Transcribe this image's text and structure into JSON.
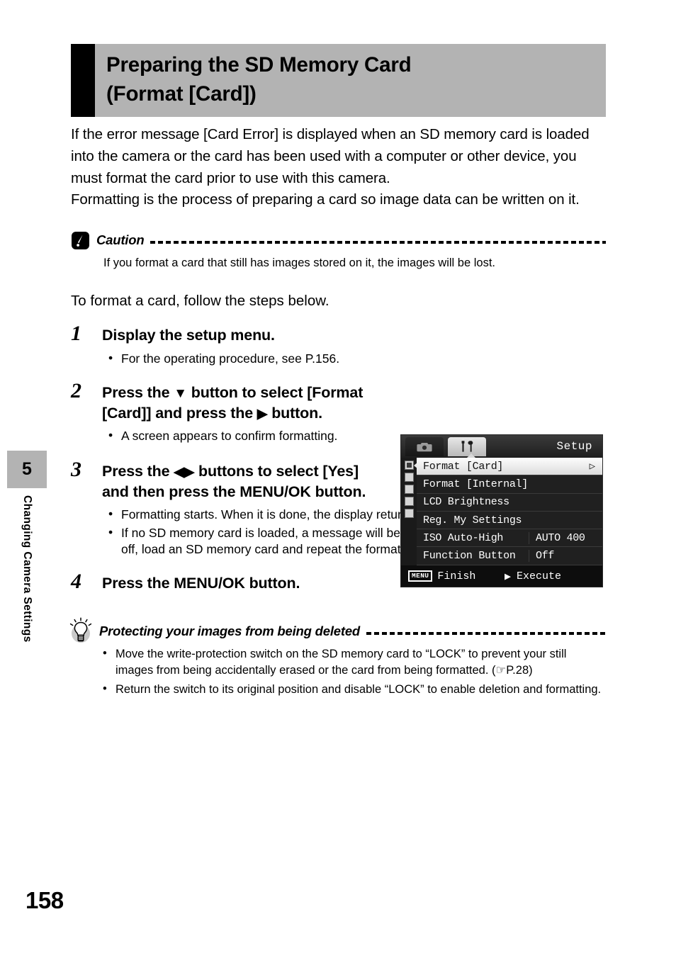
{
  "sidebar": {
    "chapter_number": "5",
    "chapter_title": "Changing Camera Settings"
  },
  "page_number": "158",
  "header": {
    "line1": "Preparing the SD Memory Card",
    "line2": "(Format [Card])"
  },
  "intro": "If the error message [Card Error] is displayed when an SD memory card is loaded into the camera or the card has been used with a computer or other device, you must format the card prior to use with this camera.\nFormatting is the process of preparing a card so image data can be written on it.",
  "caution": {
    "icon": "caution-icon",
    "title": "Caution",
    "body": "If you format a card that still has images stored on it, the images will be lost."
  },
  "lead_line": "To format a card, follow the steps below.",
  "steps": [
    {
      "number": "1",
      "title": "Display the setup menu.",
      "notes": [
        "For the operating procedure, see P.156."
      ]
    },
    {
      "number": "2",
      "title_pre": "Press the ",
      "glyph1": "▼",
      "title_mid": " button to select [Format [Card]] and press the ",
      "glyph2": "▶",
      "title_post": " button.",
      "notes": [
        "A screen appears to confirm formatting."
      ]
    },
    {
      "number": "3",
      "title_pre": "Press the ",
      "glyph1": "◀▶",
      "title_mid": " buttons to select [Yes] and then press the MENU/OK button.",
      "notes": [
        "Formatting starts. When it is done, the display returns to the setup menu.",
        "If no SD memory card is loaded, a message will be displayed. After turning the power off, load an SD memory card and repeat the formatting process again."
      ]
    },
    {
      "number": "4",
      "title": "Press the MENU/OK button.",
      "notes": []
    }
  ],
  "tip": {
    "icon": "lightbulb-icon",
    "title": "Protecting your images from being deleted",
    "notes": [
      "Move the write-protection switch on the SD memory card to “LOCK” to prevent your still images from being accidentally erased or the card from being formatted. (☞P.28)",
      "Return the switch to its original position and disable “LOCK” to enable deletion and formatting."
    ]
  },
  "lcd": {
    "tab_shooting_icon": "camera-icon",
    "tab_setup_icon": "tools-icon",
    "title": "Setup",
    "rows": [
      {
        "label": "Format [Card]",
        "value": "",
        "selected": true,
        "caret": "▷"
      },
      {
        "label": "Format [Internal]",
        "value": "",
        "selected": false,
        "caret": ""
      },
      {
        "label": "LCD Brightness",
        "value": "",
        "selected": false,
        "caret": ""
      },
      {
        "label": "Reg. My Settings",
        "value": "",
        "selected": false,
        "caret": ""
      },
      {
        "label": "ISO Auto-High",
        "value": "AUTO 400",
        "selected": false,
        "caret": ""
      },
      {
        "label": "Function Button",
        "value": "Off",
        "selected": false,
        "caret": ""
      }
    ],
    "rail_count": 5,
    "bottom": {
      "menu_key": "MENU",
      "finish_label": "Finish",
      "execute_glyph": "▶",
      "execute_label": "Execute"
    }
  }
}
